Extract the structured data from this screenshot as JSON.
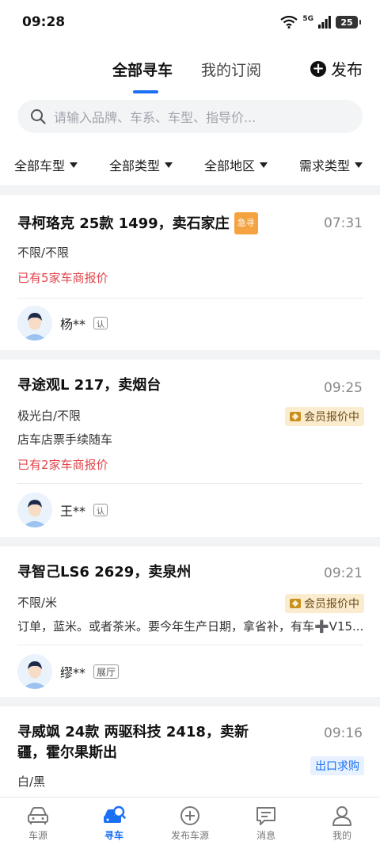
{
  "status": {
    "time": "09:28",
    "network": "5G",
    "battery": "25"
  },
  "tabs": [
    {
      "label": "全部寻车",
      "active": true
    },
    {
      "label": "我的订阅",
      "active": false
    }
  ],
  "publish_label": "发布",
  "search": {
    "placeholder": "请输入品牌、车系、车型、指导价..."
  },
  "filters": [
    {
      "label": "全部车型"
    },
    {
      "label": "全部类型"
    },
    {
      "label": "全部地区"
    },
    {
      "label": "需求类型"
    }
  ],
  "cards": [
    {
      "title": "寻柯珞克 25款 1499，卖石家庄",
      "badge": "急寻",
      "time": "07:31",
      "color": "不限/不限",
      "quote": "已有5家车商报价",
      "user": "杨**",
      "user_tag": "认"
    },
    {
      "title": "寻途观L 217，卖烟台",
      "time": "09:25",
      "color": "极光白/不限",
      "member_badge": "会员报价中",
      "note": "店车店票手续随车",
      "quote": "已有2家车商报价",
      "user": "王**",
      "user_tag": "认"
    },
    {
      "title": "寻智己LS6 2629，卖泉州",
      "time": "09:21",
      "color": "不限/米",
      "member_badge": "会员报价中",
      "note": "订单，蓝米。或者茶米。要今年生产日期，拿省补，有车➕V15...",
      "user": "缪**",
      "user_tag": "展厅"
    },
    {
      "title_line1": "寻威飒 24款 两驱科技 2418，卖新",
      "title_line2": "疆，霍尔果斯出",
      "time": "09:16",
      "export_badge": "出口求购",
      "color": "白/黑"
    }
  ],
  "bottom_nav": [
    {
      "label": "车源",
      "icon": "car-icon",
      "active": false
    },
    {
      "label": "寻车",
      "icon": "find-car-icon",
      "active": true
    },
    {
      "label": "发布车源",
      "icon": "add-circle-icon",
      "active": false
    },
    {
      "label": "消息",
      "icon": "message-icon",
      "active": false
    },
    {
      "label": "我的",
      "icon": "profile-icon",
      "active": false
    }
  ],
  "colors": {
    "accent": "#1a6ff5",
    "quote": "#e0474c",
    "urgent": "#f5a341"
  }
}
